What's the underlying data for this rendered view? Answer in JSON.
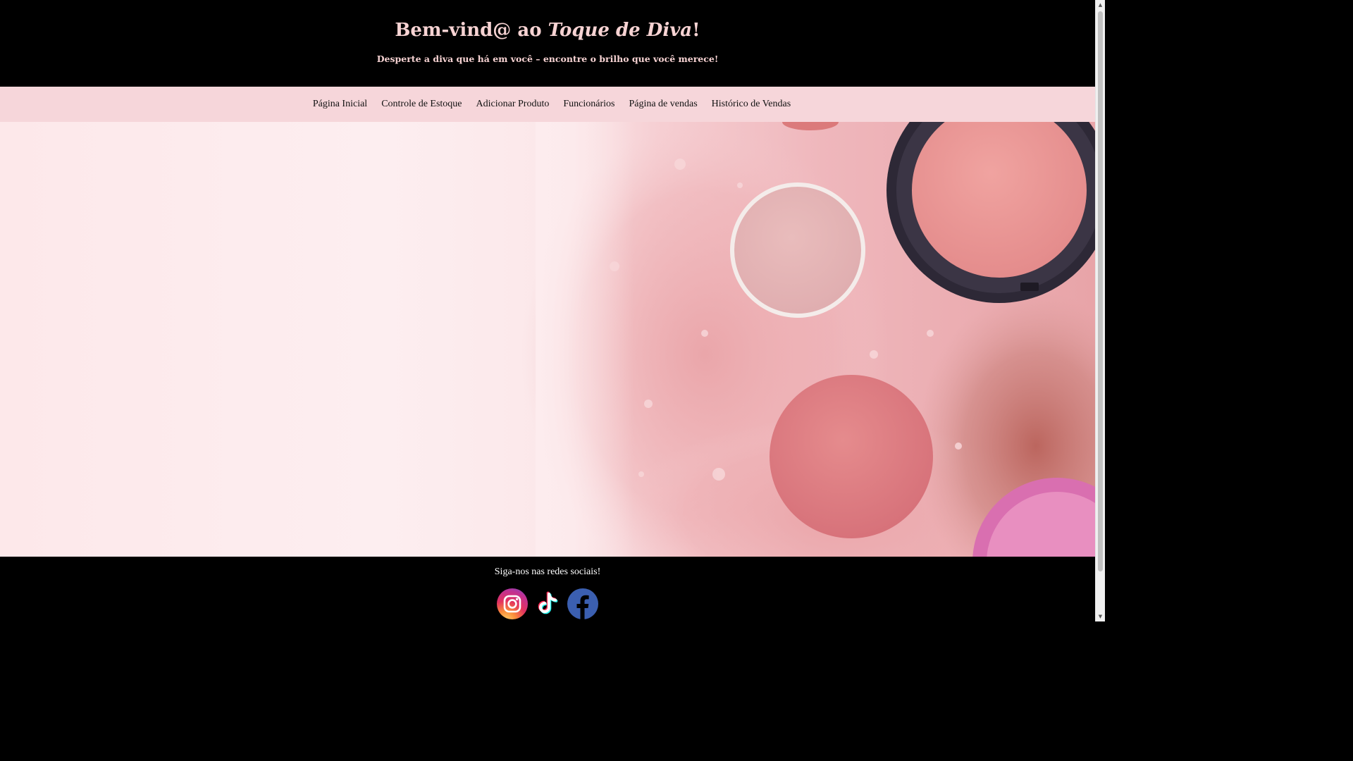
{
  "header": {
    "title_prefix": "Bem-vind@ ao ",
    "title_brand": "Toque de Diva",
    "title_suffix": "!",
    "tagline": "Desperte a diva que há em você – encontre o brilho que você merece!"
  },
  "nav": {
    "items": [
      {
        "label": "Página Inicial"
      },
      {
        "label": "Controle de Estoque"
      },
      {
        "label": "Adicionar Produto"
      },
      {
        "label": "Funcionários"
      },
      {
        "label": "Página de vendas"
      },
      {
        "label": "Histórico de Vendas"
      }
    ]
  },
  "hero": {
    "image": "pink-blush-makeup-powder-compacts"
  },
  "footer": {
    "text": "Siga-nos nas redes sociais!",
    "social": [
      {
        "icon": "instagram-icon"
      },
      {
        "icon": "tiktok-icon"
      },
      {
        "icon": "facebook-icon"
      }
    ]
  },
  "colors": {
    "header_bg": "#000000",
    "title_color": "#f7d3d3",
    "nav_bg": "#f6d6da",
    "footer_bg": "#000000"
  }
}
